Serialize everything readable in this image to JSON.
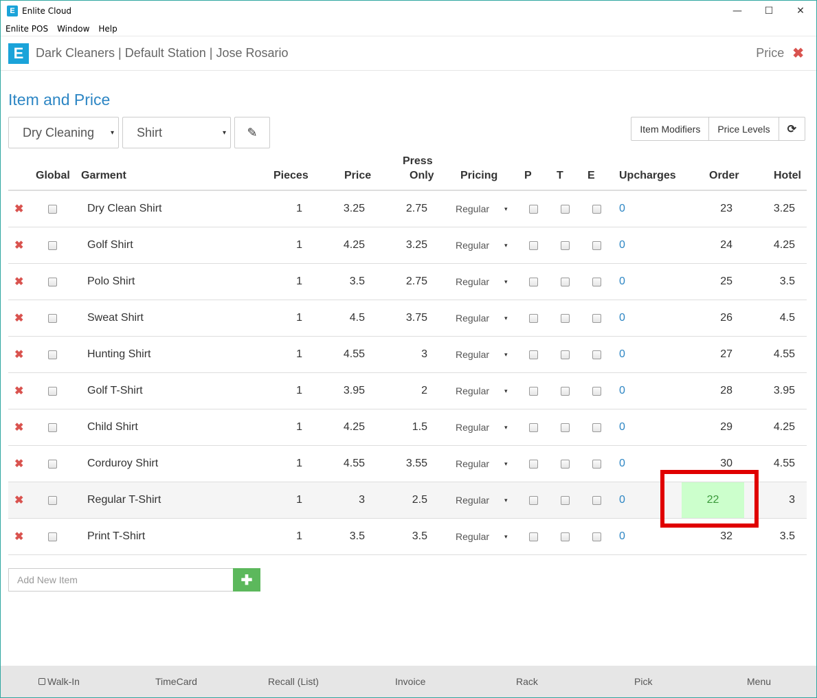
{
  "window": {
    "title": "Enlite Cloud",
    "minimize": "—",
    "maximize": "☐",
    "close": "✕",
    "icon_letter": "E"
  },
  "menu": [
    "Enlite POS",
    "Window",
    "Help"
  ],
  "header": {
    "station": "Dark Cleaners | Default Station | Jose Rosario",
    "right_label": "Price",
    "close_glyph": "✖",
    "logo_letter": "E"
  },
  "page": {
    "title": "Item and Price"
  },
  "filters": {
    "category": "Dry Cleaning",
    "subcategory": "Shirt",
    "caret": "▾"
  },
  "buttons": {
    "item_modifiers": "Item Modifiers",
    "price_levels": "Price Levels",
    "refresh": "⟳",
    "edit": "✎"
  },
  "table": {
    "headers": {
      "global": "Global",
      "garment": "Garment",
      "pieces": "Pieces",
      "price": "Price",
      "press_only_1": "Press",
      "press_only_2": "Only",
      "pricing": "Pricing",
      "p": "P",
      "t": "T",
      "e": "E",
      "upcharges": "Upcharges",
      "order": "Order",
      "hotel": "Hotel"
    },
    "delete_glyph": "✖",
    "rows": [
      {
        "garment": "Dry Clean Shirt",
        "pieces": "1",
        "price": "3.25",
        "press_only": "2.75",
        "pricing": "Regular",
        "upcharges": "0",
        "order": "23",
        "hotel": "3.25"
      },
      {
        "garment": "Golf Shirt",
        "pieces": "1",
        "price": "4.25",
        "press_only": "3.25",
        "pricing": "Regular",
        "upcharges": "0",
        "order": "24",
        "hotel": "4.25"
      },
      {
        "garment": "Polo Shirt",
        "pieces": "1",
        "price": "3.5",
        "press_only": "2.75",
        "pricing": "Regular",
        "upcharges": "0",
        "order": "25",
        "hotel": "3.5"
      },
      {
        "garment": "Sweat Shirt",
        "pieces": "1",
        "price": "4.5",
        "press_only": "3.75",
        "pricing": "Regular",
        "upcharges": "0",
        "order": "26",
        "hotel": "4.5"
      },
      {
        "garment": "Hunting Shirt",
        "pieces": "1",
        "price": "4.55",
        "press_only": "3",
        "pricing": "Regular",
        "upcharges": "0",
        "order": "27",
        "hotel": "4.55"
      },
      {
        "garment": "Golf T-Shirt",
        "pieces": "1",
        "price": "3.95",
        "press_only": "2",
        "pricing": "Regular",
        "upcharges": "0",
        "order": "28",
        "hotel": "3.95"
      },
      {
        "garment": "Child Shirt",
        "pieces": "1",
        "price": "4.25",
        "press_only": "1.5",
        "pricing": "Regular",
        "upcharges": "0",
        "order": "29",
        "hotel": "4.25"
      },
      {
        "garment": "Corduroy Shirt",
        "pieces": "1",
        "price": "4.55",
        "press_only": "3.55",
        "pricing": "Regular",
        "upcharges": "0",
        "order": "30",
        "hotel": "4.55"
      },
      {
        "garment": "Regular T-Shirt",
        "pieces": "1",
        "price": "3",
        "press_only": "2.5",
        "pricing": "Regular",
        "upcharges": "0",
        "order": "22",
        "hotel": "3",
        "highlighted": true
      },
      {
        "garment": "Print T-Shirt",
        "pieces": "1",
        "price": "3.5",
        "press_only": "3.5",
        "pricing": "Regular",
        "upcharges": "0",
        "order": "32",
        "hotel": "3.5"
      }
    ]
  },
  "add_item": {
    "placeholder": "Add New Item",
    "button": "✚"
  },
  "footer": {
    "walkin": "Walk-In",
    "timecard": "TimeCard",
    "recall": "Recall (List)",
    "invoice": "Invoice",
    "rack": "Rack",
    "pick": "Pick",
    "menu": "Menu"
  },
  "colors": {
    "accent": "#2d86c4",
    "brand": "#1aa3d9",
    "delete": "#d9534f",
    "add": "#5cb85c",
    "order_highlight": "#ccffcc",
    "annotation_box": "#e00000"
  }
}
